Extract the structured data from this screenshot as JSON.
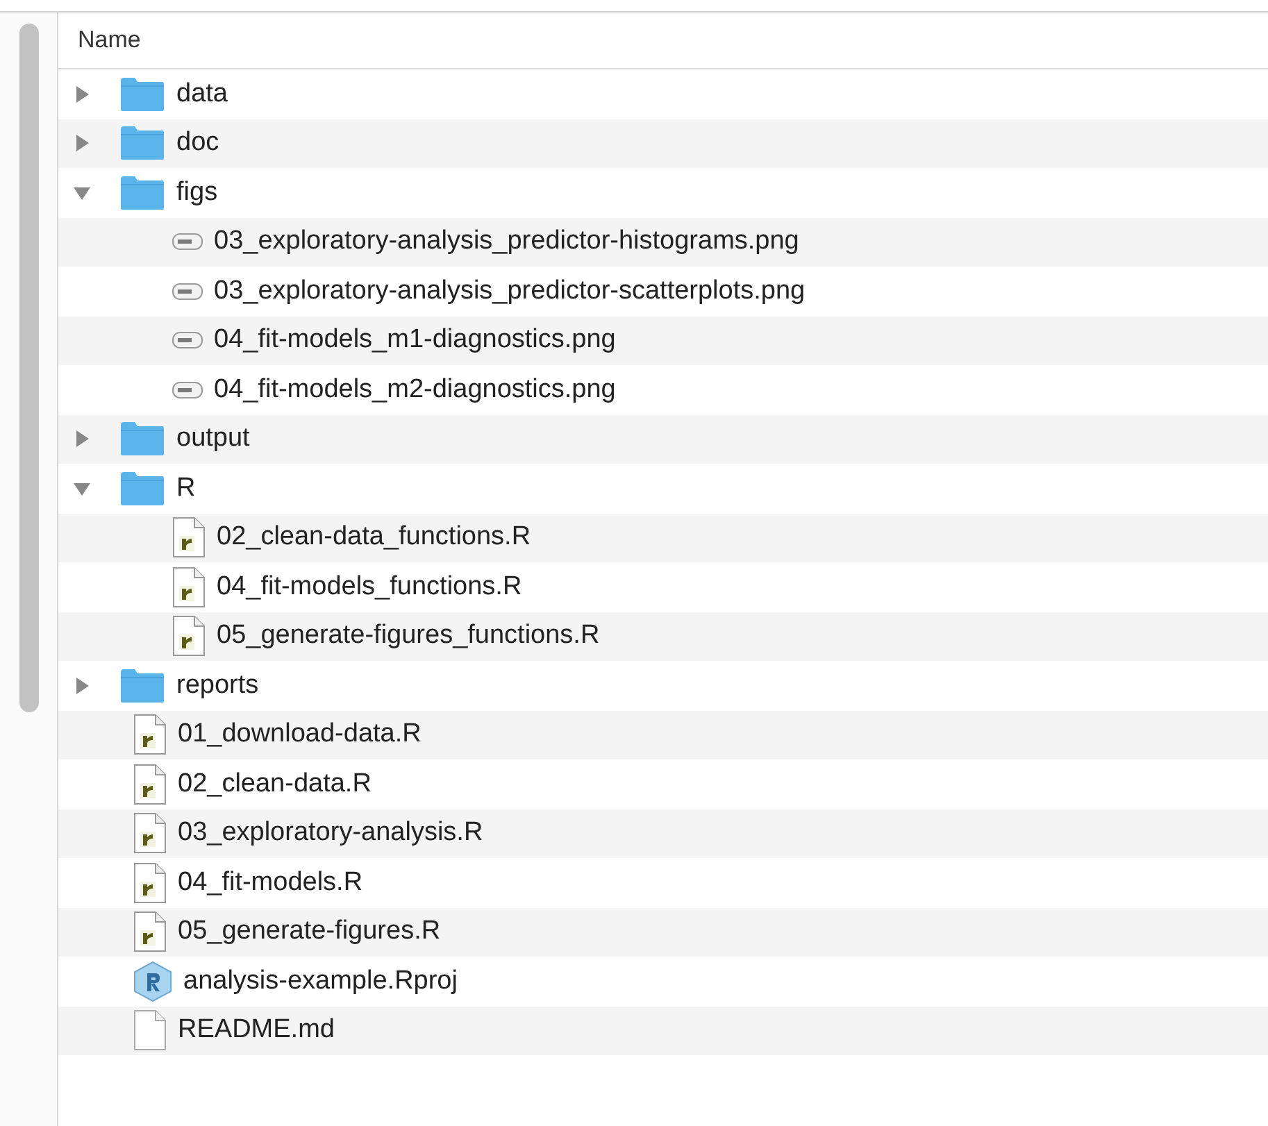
{
  "header": {
    "name_column": "Name"
  },
  "items": [
    {
      "kind": "folder",
      "name": "data",
      "expanded": false
    },
    {
      "kind": "folder",
      "name": "doc",
      "expanded": false
    },
    {
      "kind": "folder",
      "name": "figs",
      "expanded": true,
      "children": [
        {
          "kind": "image",
          "name": "03_exploratory-analysis_predictor-histograms.png"
        },
        {
          "kind": "image",
          "name": "03_exploratory-analysis_predictor-scatterplots.png"
        },
        {
          "kind": "image",
          "name": "04_fit-models_m1-diagnostics.png"
        },
        {
          "kind": "image",
          "name": "04_fit-models_m2-diagnostics.png"
        }
      ]
    },
    {
      "kind": "folder",
      "name": "output",
      "expanded": false
    },
    {
      "kind": "folder",
      "name": "R",
      "expanded": true,
      "children": [
        {
          "kind": "r-script",
          "name": "02_clean-data_functions.R"
        },
        {
          "kind": "r-script",
          "name": "04_fit-models_functions.R"
        },
        {
          "kind": "r-script",
          "name": "05_generate-figures_functions.R"
        }
      ]
    },
    {
      "kind": "folder",
      "name": "reports",
      "expanded": false
    },
    {
      "kind": "r-script",
      "name": "01_download-data.R"
    },
    {
      "kind": "r-script",
      "name": "02_clean-data.R"
    },
    {
      "kind": "r-script",
      "name": "03_exploratory-analysis.R"
    },
    {
      "kind": "r-script",
      "name": "04_fit-models.R"
    },
    {
      "kind": "r-script",
      "name": "05_generate-figures.R"
    },
    {
      "kind": "rproj",
      "name": "analysis-example.Rproj"
    },
    {
      "kind": "text",
      "name": "README.md"
    }
  ]
}
